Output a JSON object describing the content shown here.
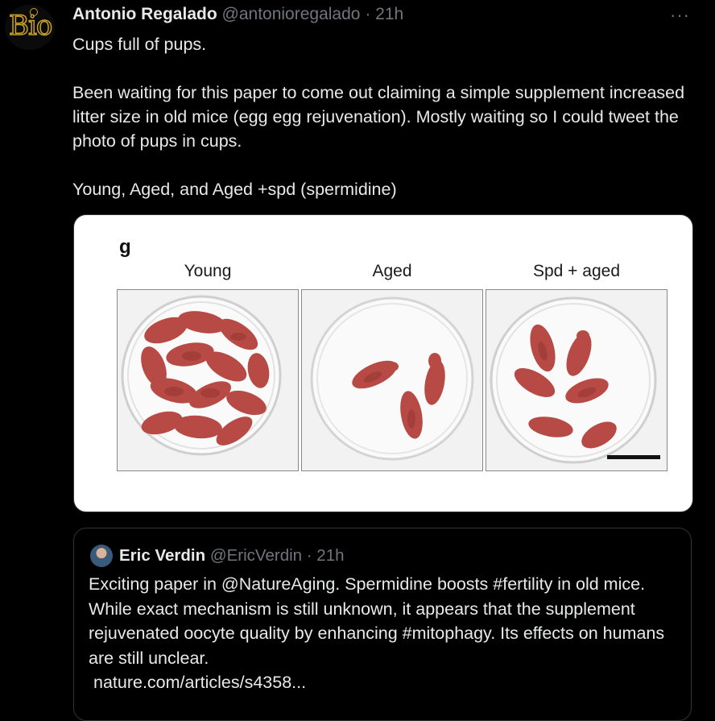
{
  "tweet": {
    "avatar_text": "Bio",
    "author_name": "Antonio Regalado",
    "handle": "@antonioregalado",
    "separator": "·",
    "time": "21h",
    "more_icon": "more-horizontal-icon",
    "lines": [
      "Cups full of pups.",
      "Been waiting for this paper to come out claiming a simple supplement increased litter size in old mice (egg egg rejuvenation). Mostly waiting so I could tweet the photo of pups in cups.",
      "Young, Aged, and Aged +spd (spermidine)"
    ]
  },
  "media": {
    "figure_letter": "g",
    "panels": [
      "Young",
      "Aged",
      "Spd + aged"
    ]
  },
  "quote": {
    "author_name": "Eric Verdin",
    "handle": "@EricVerdin",
    "separator": "·",
    "time": "21h",
    "body": "Exciting paper in @NatureAging. Spermidine boosts #fertility in old mice. While exact mechanism is still unknown, it appears that the supplement rejuvenated oocyte quality by enhancing #mitophagy. Its effects on humans are still unclear.",
    "link": "nature.com/articles/s4358..."
  },
  "colors": {
    "background": "#000000",
    "text": "#e7e9ea",
    "muted": "#71767b",
    "pup": "#b84a45",
    "avatar_accent": "#c9a227"
  }
}
